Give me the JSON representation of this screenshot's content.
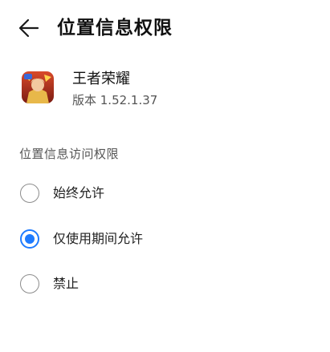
{
  "header": {
    "back_icon": "arrow-left-icon",
    "title": "位置信息权限"
  },
  "app": {
    "icon": "app-logo-icon",
    "name": "王者荣耀",
    "version": "版本 1.52.1.37"
  },
  "section": {
    "title": "位置信息访问权限"
  },
  "options": [
    {
      "label": "始终允许",
      "selected": false
    },
    {
      "label": "仅使用期间允许",
      "selected": true
    },
    {
      "label": "禁止",
      "selected": false
    }
  ],
  "colors": {
    "accent": "#1e7bff",
    "radio_border": "#8c8c8c"
  }
}
